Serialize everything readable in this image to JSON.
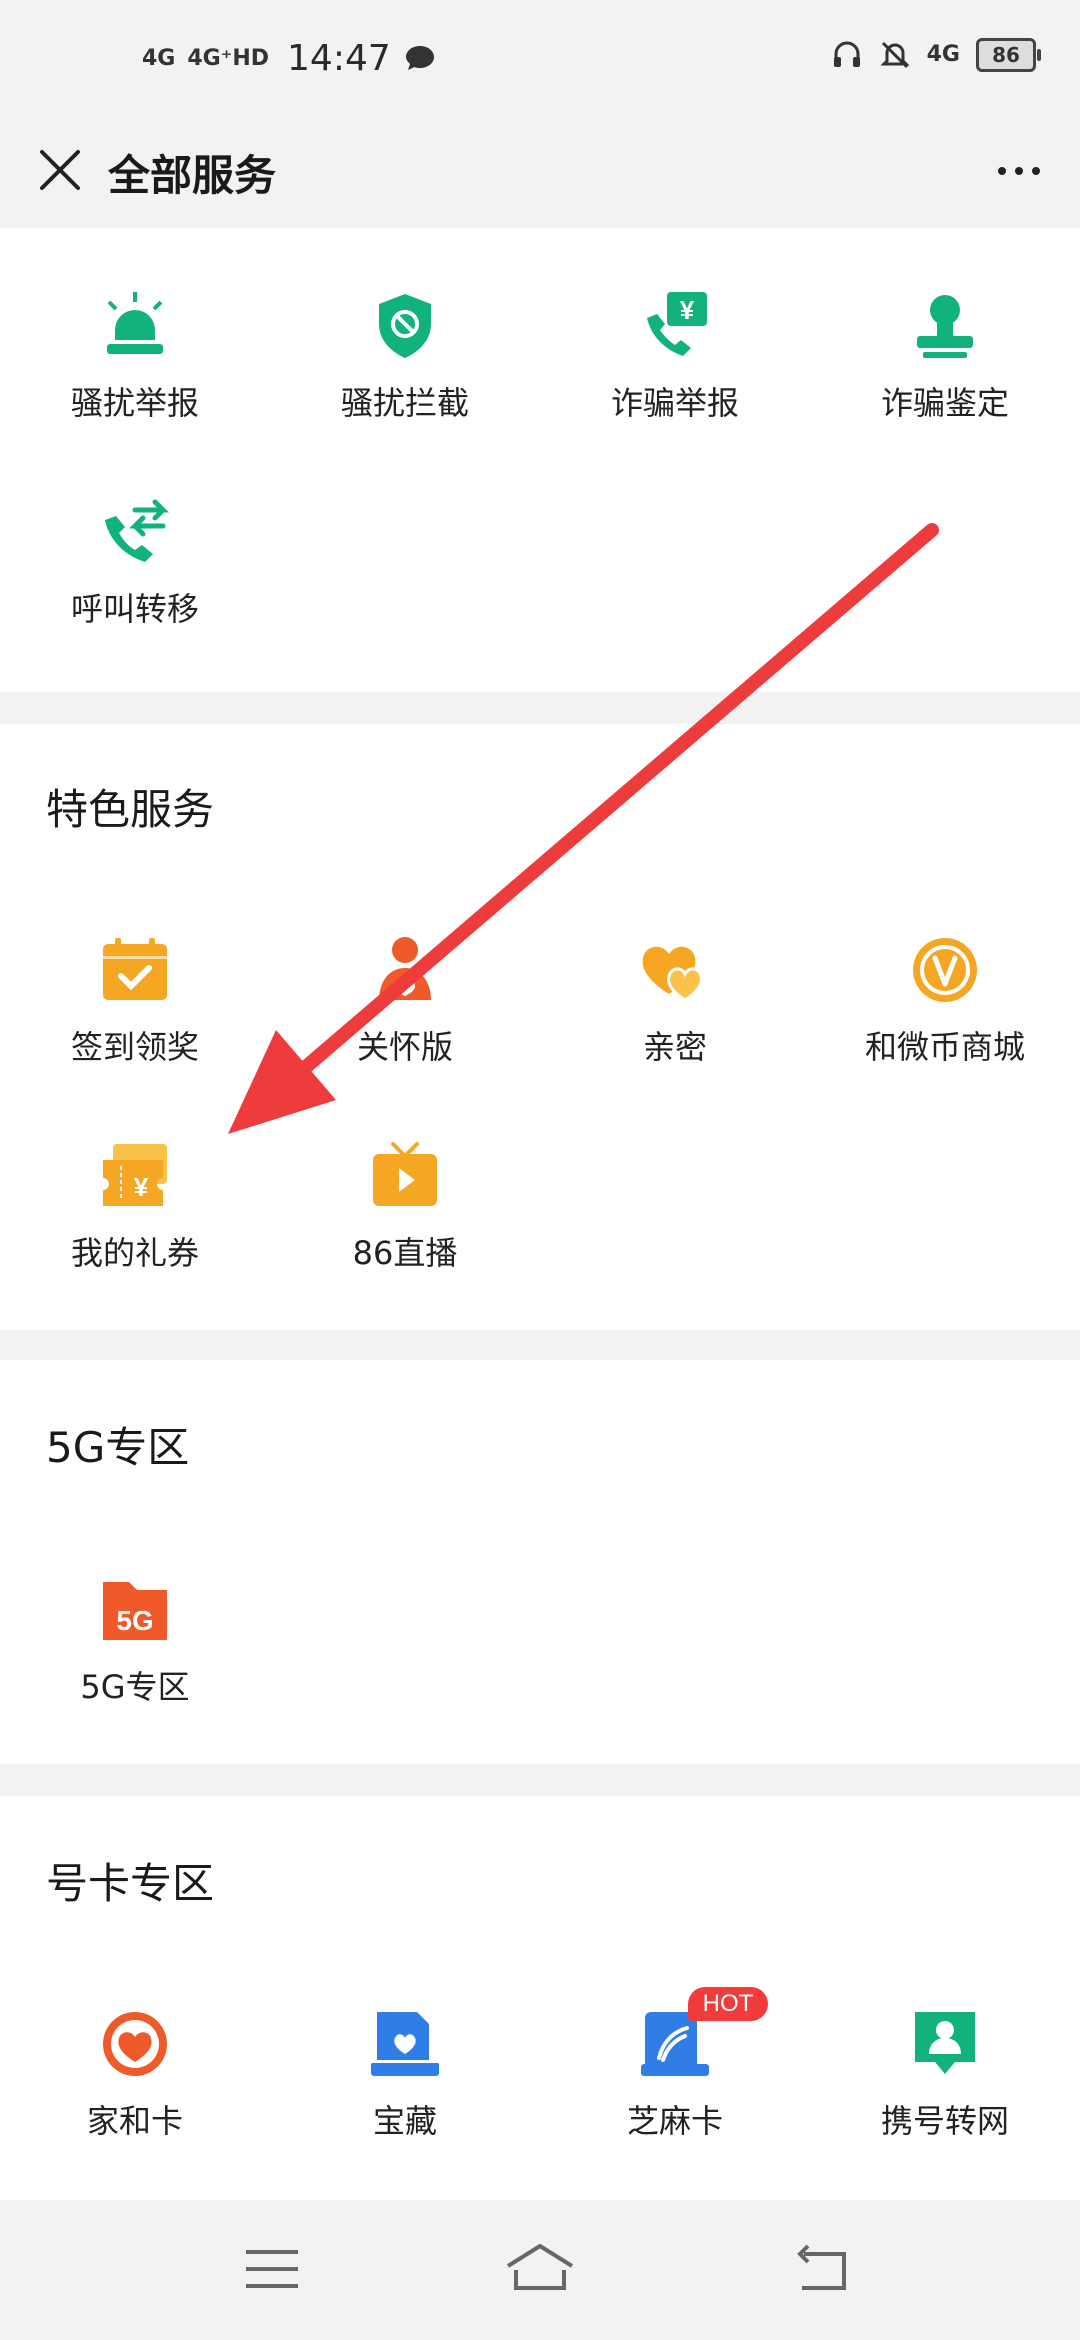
{
  "status_bar": {
    "signal1": "4G",
    "signal2": "4G⁺HD",
    "time": "14:47",
    "signal3": "4G",
    "battery": "86"
  },
  "header": {
    "title": "全部服务"
  },
  "security": {
    "items": [
      {
        "label": "骚扰举报",
        "icon": "alarm-light-icon"
      },
      {
        "label": "骚扰拦截",
        "icon": "shield-block-icon"
      },
      {
        "label": "诈骗举报",
        "icon": "phone-yuan-icon"
      },
      {
        "label": "诈骗鉴定",
        "icon": "stamp-icon"
      },
      {
        "label": "呼叫转移",
        "icon": "call-forward-icon"
      }
    ]
  },
  "featured": {
    "title": "特色服务",
    "items": [
      {
        "label": "签到领奖",
        "icon": "calendar-check-icon"
      },
      {
        "label": "关怀版",
        "icon": "care-person-icon"
      },
      {
        "label": "亲密",
        "icon": "hearts-icon"
      },
      {
        "label": "和微币商城",
        "icon": "coin-v-icon"
      },
      {
        "label": "我的礼券",
        "icon": "coupon-icon"
      },
      {
        "label": "86直播",
        "icon": "tv-play-icon"
      }
    ]
  },
  "fiveg": {
    "title": "5G专区",
    "items": [
      {
        "label": "5G专区",
        "icon": "5g-folder-icon",
        "icon_text": "5G"
      }
    ]
  },
  "cards": {
    "title": "号卡专区",
    "items": [
      {
        "label": "家和卡",
        "icon": "heart-circle-icon"
      },
      {
        "label": "宝藏",
        "icon": "treasure-icon"
      },
      {
        "label": "芝麻卡",
        "icon": "sesame-card-icon",
        "badge": "HOT"
      },
      {
        "label": "携号转网",
        "icon": "portability-icon"
      }
    ]
  },
  "colors": {
    "green": "#12b27c",
    "orange": "#f5a623",
    "red_orange": "#f05a2a",
    "blue": "#2f7ee8",
    "annotation": "#ee3b3b"
  }
}
